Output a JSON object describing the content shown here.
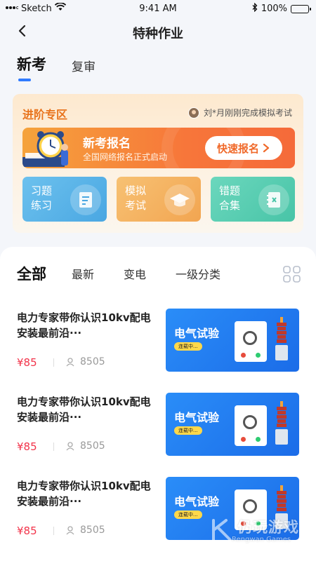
{
  "status_bar": {
    "carrier": "Sketch",
    "time": "9:41 AM",
    "battery": "100%"
  },
  "nav": {
    "title": "特种作业"
  },
  "tabs": [
    {
      "label": "新考",
      "active": true
    },
    {
      "label": "复审",
      "active": false
    }
  ],
  "advanced": {
    "title": "进阶专区",
    "notice": "刘*月刚刚完成模拟考试",
    "banner": {
      "title": "新考报名",
      "subtitle": "全国网络报名正式启动",
      "button": "快速报名"
    },
    "cards": [
      {
        "line1": "习题",
        "line2": "练习",
        "icon": "document-icon"
      },
      {
        "line1": "模拟",
        "line2": "考试",
        "icon": "graduation-cap-icon"
      },
      {
        "line1": "错题",
        "line2": "合集",
        "icon": "notebook-icon"
      }
    ]
  },
  "filters": [
    {
      "label": "全部",
      "active": true
    },
    {
      "label": "最新",
      "active": false
    },
    {
      "label": "变电",
      "active": false
    },
    {
      "label": "一级分类",
      "active": false
    }
  ],
  "courses": [
    {
      "title": "电力专家带你认识10kv配电安装最前沿···",
      "price": "¥85",
      "students": "8505",
      "thumb_title": "电气试验",
      "thumb_badge": "连载中..."
    },
    {
      "title": "电力专家带你认识10kv配电安装最前沿···",
      "price": "¥85",
      "students": "8505",
      "thumb_title": "电气试验",
      "thumb_badge": "连载中..."
    },
    {
      "title": "电力专家带你认识10kv配电安装最前沿···",
      "price": "¥85",
      "students": "8505",
      "thumb_title": "电气试验",
      "thumb_badge": "连载中..."
    }
  ],
  "watermark": {
    "text": "仍玩游戏",
    "sub": "Rengwan Games"
  },
  "colors": {
    "accent": "#2f7bff",
    "orange": "#f06a2b",
    "price": "#f2334a"
  }
}
